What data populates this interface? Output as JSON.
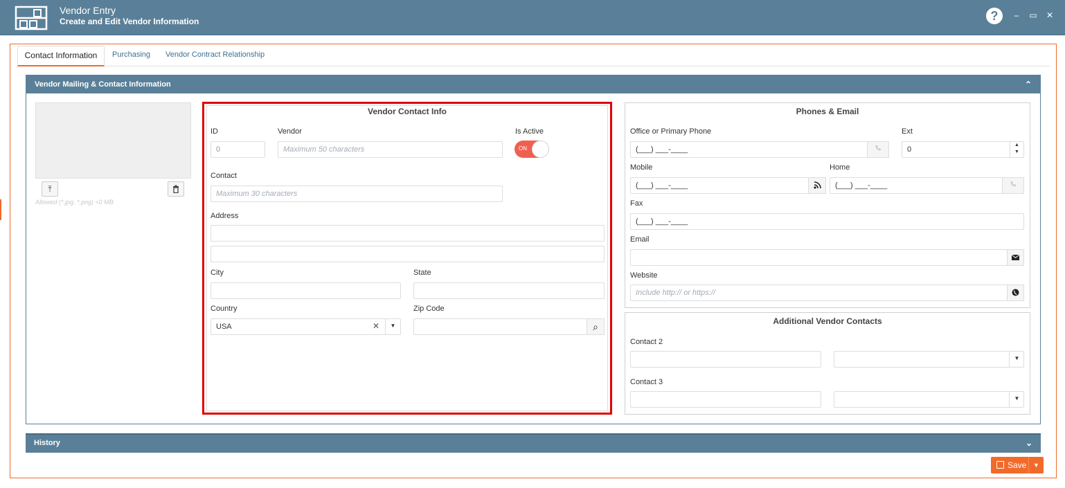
{
  "window": {
    "title": "Vendor Entry",
    "subtitle": "Create and Edit Vendor Information",
    "help_icon": "?",
    "minimize_glyph": "–",
    "maximize_glyph": "▭",
    "close_glyph": "✕"
  },
  "tabs": [
    {
      "label": "Contact Information",
      "active": true
    },
    {
      "label": "Purchasing",
      "active": false
    },
    {
      "label": "Vendor Contract Relationship",
      "active": false
    }
  ],
  "panel": {
    "title": "Vendor Mailing & Contact Information",
    "collapse_glyph": "⌃"
  },
  "image_upload": {
    "hint": "Allowed (*.jpg, *.png) <0 MB",
    "upload_glyph": "⤒",
    "delete_glyph": "🗑"
  },
  "vendor_contact": {
    "title": "Vendor Contact Info",
    "id_label": "ID",
    "id_value": "0",
    "vendor_label": "Vendor",
    "vendor_placeholder": "Maximum 50 characters",
    "is_active_label": "Is Active",
    "is_active_toggle": "ON",
    "contact_label": "Contact",
    "contact_placeholder": "Maximum 30 characters",
    "address_label": "Address",
    "city_label": "City",
    "state_label": "State",
    "country_label": "Country",
    "country_value": "USA",
    "clear_glyph": "✕",
    "dropdown_glyph": "▼",
    "zip_label": "Zip Code",
    "search_glyph": "⌕"
  },
  "phones_email": {
    "title": "Phones & Email",
    "office_label": "Office or Primary Phone",
    "office_value": "(___) ___-____",
    "ext_label": "Ext",
    "ext_value": "0",
    "mobile_label": "Mobile",
    "mobile_value": "(___) ___-____",
    "home_label": "Home",
    "home_value": "(___) ___-____",
    "fax_label": "Fax",
    "fax_value": "(___) ___-____",
    "email_label": "Email",
    "website_label": "Website",
    "website_placeholder": "Include http:// or https://",
    "rss_glyph": "))",
    "envelope_glyph": "✉",
    "globe_glyph": "●",
    "spin_up": "▲",
    "spin_down": "▼"
  },
  "additional_contacts": {
    "title": "Additional Vendor Contacts",
    "contact2_label": "Contact 2",
    "contact3_label": "Contact 3",
    "dropdown_glyph": "▼"
  },
  "history": {
    "title": "History",
    "expand_glyph": "⌄"
  },
  "save": {
    "label": "Save",
    "caret": "▼"
  },
  "colors": {
    "header": "#5a8099",
    "accent": "#f26a2a",
    "highlight_frame": "#e00000",
    "toggle_on": "#f06050"
  }
}
